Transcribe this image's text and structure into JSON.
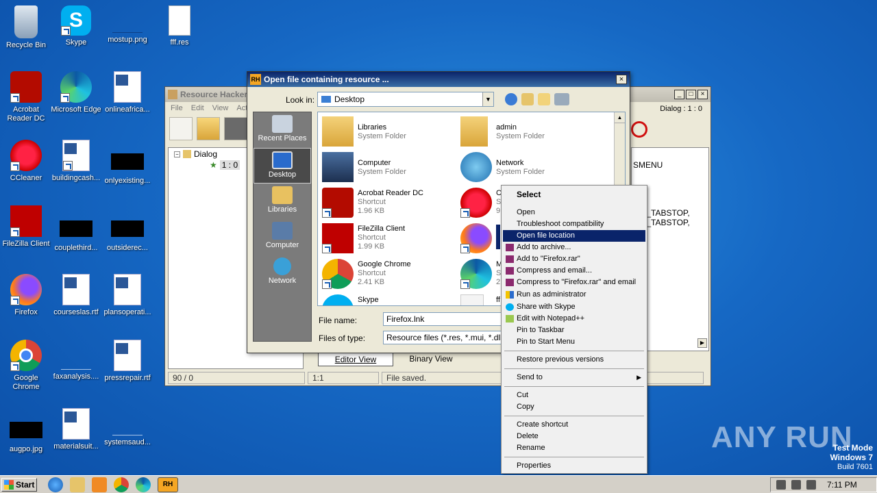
{
  "desktop": {
    "icons": [
      {
        "label": "Recycle Bin"
      },
      {
        "label": "Skype"
      },
      {
        "label": "mostup.png"
      },
      {
        "label": "fff.res"
      },
      {
        "label": "Acrobat Reader DC"
      },
      {
        "label": "Microsoft Edge"
      },
      {
        "label": "onlineafrica..."
      },
      {
        "label": "CCleaner"
      },
      {
        "label": "buildingcash..."
      },
      {
        "label": "onlyexisting..."
      },
      {
        "label": "FileZilla Client"
      },
      {
        "label": "couplethird..."
      },
      {
        "label": "outsiderec..."
      },
      {
        "label": "Firefox"
      },
      {
        "label": "courseslas.rtf"
      },
      {
        "label": "plansoperati..."
      },
      {
        "label": "Google Chrome"
      },
      {
        "label": "faxanalysis...."
      },
      {
        "label": "pressrepair.rtf"
      },
      {
        "label": "augpo.jpg"
      },
      {
        "label": "materialsuit..."
      },
      {
        "label": "systemsaud..."
      }
    ]
  },
  "rh_window": {
    "title": "Resource Hacker",
    "menu": [
      "File",
      "Edit",
      "View",
      "Acti"
    ],
    "dialog_label": "Dialog : 1 : 0",
    "tree": {
      "root": "Dialog",
      "child": "1 : 0"
    },
    "editor_lines": [
      "SMENU",
      "",
      "",
      "WS_TABSTOP,",
      "WS_TABSTOP,"
    ],
    "tabs": {
      "editor": "Editor View",
      "binary": "Binary View"
    },
    "status": {
      "pos": "90 / 0",
      "line": "1:1",
      "msg": "File saved."
    }
  },
  "dialog": {
    "title": "Open file containing resource ...",
    "look_in_label": "Look in:",
    "look_in_value": "Desktop",
    "places": [
      {
        "label": "Recent Places"
      },
      {
        "label": "Desktop"
      },
      {
        "label": "Libraries"
      },
      {
        "label": "Computer"
      },
      {
        "label": "Network"
      }
    ],
    "files": [
      {
        "name": "Libraries",
        "type": "System Folder",
        "size": ""
      },
      {
        "name": "admin",
        "type": "System Folder",
        "size": ""
      },
      {
        "name": "Computer",
        "type": "System Folder",
        "size": ""
      },
      {
        "name": "Network",
        "type": "System Folder",
        "size": ""
      },
      {
        "name": "Acrobat Reader DC",
        "type": "Shortcut",
        "size": "1.96 KB"
      },
      {
        "name": "C",
        "type": "S",
        "size": "9"
      },
      {
        "name": "FileZilla Client",
        "type": "Shortcut",
        "size": "1.99 KB"
      },
      {
        "name": "",
        "type": "",
        "size": ""
      },
      {
        "name": "Google Chrome",
        "type": "Shortcut",
        "size": "2.41 KB"
      },
      {
        "name": "M",
        "type": "S",
        "size": "2"
      },
      {
        "name": "Skype",
        "type": "",
        "size": ""
      },
      {
        "name": "ff",
        "type": "",
        "size": ""
      }
    ],
    "file_name_label": "File name:",
    "file_name_value": "Firefox.lnk",
    "file_type_label": "Files of type:",
    "file_type_value": "Resource files (*.res, *.mui, *.dll, *.ex"
  },
  "context_menu": {
    "items": [
      {
        "label": "Select",
        "bold": true
      },
      {
        "label": "Open"
      },
      {
        "label": "Troubleshoot compatibility"
      },
      {
        "label": "Open file location",
        "highlighted": true
      },
      {
        "label": "Add to archive..."
      },
      {
        "label": "Add to \"Firefox.rar\""
      },
      {
        "label": "Compress and email..."
      },
      {
        "label": "Compress to \"Firefox.rar\" and email"
      },
      {
        "label": "Run as administrator"
      },
      {
        "label": "Share with Skype"
      },
      {
        "label": "Edit with Notepad++"
      },
      {
        "label": "Pin to Taskbar"
      },
      {
        "label": "Pin to Start Menu"
      },
      {
        "label": "Restore previous versions"
      },
      {
        "label": "Send to"
      },
      {
        "label": "Cut"
      },
      {
        "label": "Copy"
      },
      {
        "label": "Create shortcut"
      },
      {
        "label": "Delete"
      },
      {
        "label": "Rename"
      },
      {
        "label": "Properties"
      }
    ]
  },
  "watermark": {
    "text": "ANY RUN",
    "line1": "Test Mode",
    "line2": "Windows 7",
    "line3": "Build 7601"
  },
  "taskbar": {
    "start": "Start",
    "clock": "7:11 PM"
  },
  "colors": {
    "accent": "#0a246a",
    "desktop": "#1668c4"
  }
}
